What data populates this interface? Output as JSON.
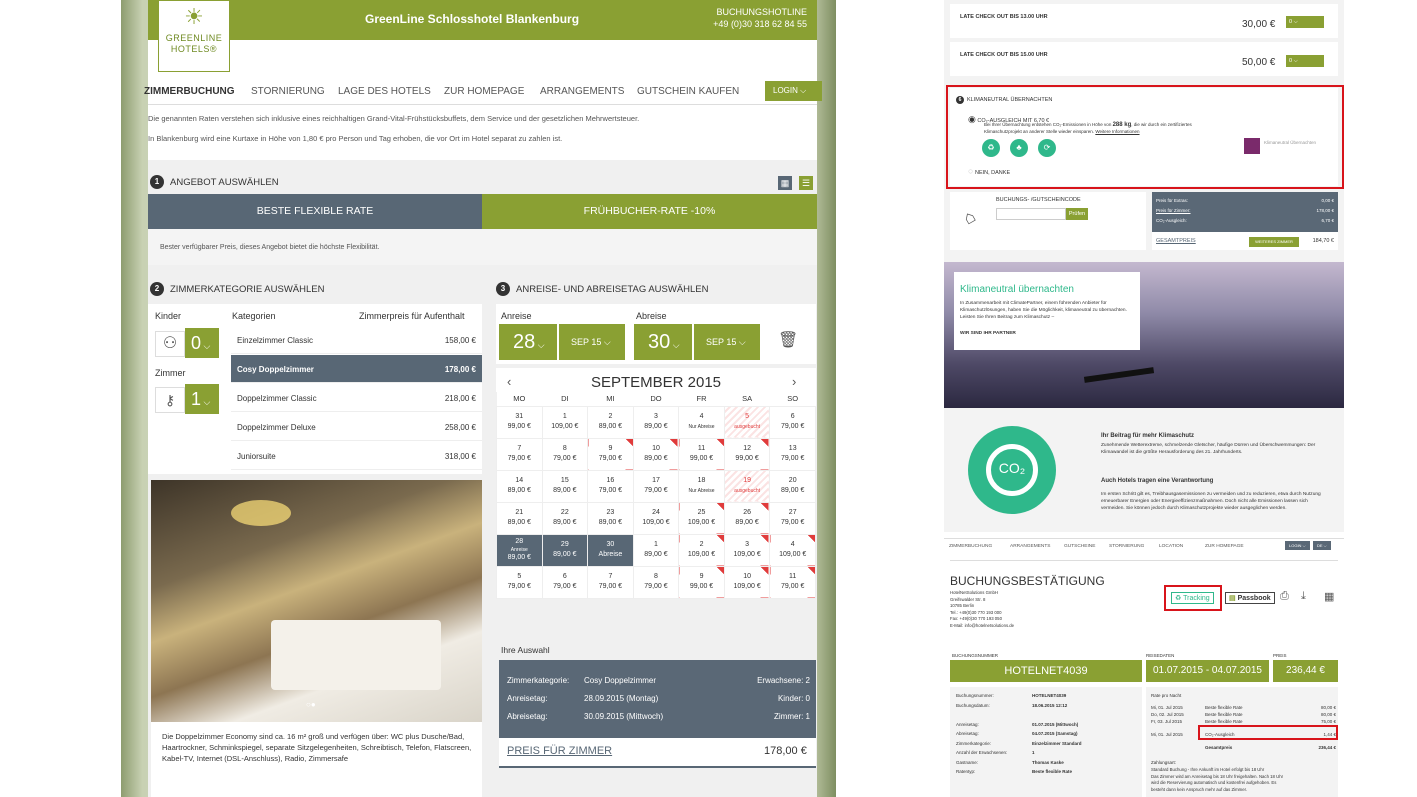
{
  "header": {
    "title": "GreenLine Schlosshotel Blankenburg",
    "hotline_label": "BUCHUNGSHOTLINE",
    "hotline_phone": "+49 (0)30 318 62 84 55",
    "logo_top": "GREENLINE",
    "logo_bottom": "HOTELS®"
  },
  "nav": {
    "items": [
      "ZIMMERBUCHUNG",
      "STORNIERUNG",
      "LAGE DES HOTELS",
      "ZUR HOMEPAGE",
      "ARRANGEMENTS",
      "GUTSCHEIN KAUFEN"
    ],
    "login": "LOGIN"
  },
  "info": {
    "line1": "Die genannten Raten verstehen sich inklusive eines reichhaltigen Grand-Vital-Frühstücksbuffets, dem Service und der gesetzlichen Mehrwertsteuer.",
    "line2": "In Blankenburg wird eine Kurtaxe in Höhe von 1,80 € pro Person und Tag erhoben, die vor Ort im Hotel separat zu zahlen ist."
  },
  "step1": {
    "num": "1",
    "title": "ANGEBOT AUSWÄHLEN",
    "tab1": "BESTE FLEXIBLE RATE",
    "tab2": "FRÜHBUCHER-RATE -10%",
    "desc": "Bester verfügbarer Preis, dieses Angebot bietet die höchste Flexibilität."
  },
  "step2": {
    "num": "2",
    "title": "ZIMMERKATEGORIE AUSWÄHLEN",
    "kinder_label": "Kinder",
    "kinder_value": "0",
    "zimmer_label": "Zimmer",
    "zimmer_value": "1",
    "col_categories": "Kategorien",
    "col_price": "Zimmerpreis für Aufenthalt",
    "rooms": [
      {
        "name": "Einzelzimmer Classic",
        "price": "158,00 €"
      },
      {
        "name": "Cosy Doppelzimmer",
        "price": "178,00 €"
      },
      {
        "name": "Doppelzimmer Classic",
        "price": "218,00 €"
      },
      {
        "name": "Doppelzimmer Deluxe",
        "price": "258,00 €"
      },
      {
        "name": "Juniorsuite",
        "price": "318,00 €"
      }
    ],
    "room_desc": "Die Doppelzimmer Economy sind ca. 16 m² groß und verfügen über: WC plus Dusche/Bad, Haartrockner, Schminkspiegel, separate Sitzgelegenheiten, Schreibtisch, Telefon, Flatscreen, Kabel-TV, Internet (DSL-Anschluss), Radio, Zimmersafe"
  },
  "step3": {
    "num": "3",
    "title": "ANREISE- UND ABREISETAG AUSWÄHLEN",
    "arrival_label": "Anreise",
    "departure_label": "Abreise",
    "arrival_day": "28",
    "arrival_month": "SEP 15",
    "departure_day": "30",
    "departure_month": "SEP 15",
    "month_title": "SEPTEMBER 2015",
    "weekdays": [
      "MO",
      "DI",
      "MI",
      "DO",
      "FR",
      "SA",
      "SO"
    ],
    "weeks": [
      [
        [
          "31",
          "99,00 €"
        ],
        [
          "1",
          "109,00 €"
        ],
        [
          "2",
          "89,00 €"
        ],
        [
          "3",
          "89,00 €"
        ],
        [
          "4",
          "Nur Abreise"
        ],
        [
          "5",
          "ausgebucht"
        ],
        [
          "6",
          "79,00 €"
        ]
      ],
      [
        [
          "7",
          "79,00 €"
        ],
        [
          "8",
          "79,00 €"
        ],
        [
          "9",
          "79,00 €"
        ],
        [
          "10",
          "89,00 €"
        ],
        [
          "11",
          "99,00 €"
        ],
        [
          "12",
          "99,00 €"
        ],
        [
          "13",
          "79,00 €"
        ]
      ],
      [
        [
          "14",
          "89,00 €"
        ],
        [
          "15",
          "89,00 €"
        ],
        [
          "16",
          "79,00 €"
        ],
        [
          "17",
          "79,00 €"
        ],
        [
          "18",
          "Nur Abreise"
        ],
        [
          "19",
          "ausgebucht"
        ],
        [
          "20",
          "89,00 €"
        ]
      ],
      [
        [
          "21",
          "89,00 €"
        ],
        [
          "22",
          "89,00 €"
        ],
        [
          "23",
          "89,00 €"
        ],
        [
          "24",
          "109,00 €"
        ],
        [
          "25",
          "109,00 €"
        ],
        [
          "26",
          "89,00 €"
        ],
        [
          "27",
          "79,00 €"
        ]
      ],
      [
        [
          "28",
          "89,00 €"
        ],
        [
          "29",
          "89,00 €"
        ],
        [
          "30",
          "Abreise"
        ],
        [
          "1",
          "89,00 €"
        ],
        [
          "2",
          "109,00 €"
        ],
        [
          "3",
          "109,00 €"
        ],
        [
          "4",
          "109,00 €"
        ]
      ],
      [
        [
          "5",
          "79,00 €"
        ],
        [
          "6",
          "79,00 €"
        ],
        [
          "7",
          "79,00 €"
        ],
        [
          "8",
          "79,00 €"
        ],
        [
          "9",
          "99,00 €"
        ],
        [
          "10",
          "109,00 €"
        ],
        [
          "11",
          "79,00 €"
        ]
      ]
    ],
    "arrival_tag": "Anreise",
    "your_choice": "Ihre Auswahl",
    "zk_label": "Zimmerkategorie:",
    "zk_value": "Cosy Doppelzimmer",
    "an_label": "Anreisetag:",
    "an_value": "28.09.2015 (Montag)",
    "ab_label": "Abreisetag:",
    "ab_value": "30.09.2015 (Mittwoch)",
    "adults": "Erwachsene: 2",
    "children": "Kinder: 0",
    "rooms": "Zimmer: 1",
    "price_link": "PREIS FÜR ZIMMER",
    "price_value": "178,00 €"
  },
  "right": {
    "late1": "LATE CHECK OUT BIS 13.00 UHR",
    "late1_price": "30,00 €",
    "late2": "LATE CHECK OUT BIS 15.00 UHR",
    "late2_price": "50,00 €",
    "qty": "0",
    "klima_title": "KLIMANEUTRAL ÜBERNACHTEN",
    "co2_option": "CO₂-AUSGLEICH MIT 6,70 €",
    "co2_text1": "Bei Ihrer Übernachtung entstehen CO₂-Emissionen in Höhe von",
    "co2_kg": "288 kg",
    "co2_text2": ", die wir durch ein zertifiziertes",
    "co2_text3": "Klimaschutzprojekt an anderer Stelle wieder einsparen.",
    "co2_more": "Weitere Informationen",
    "no_thanks": "NEIN, DANKE",
    "klima_badge": "Klimaneutral Übernachten",
    "code_label": "BUCHUNGS- /GUTSCHEINCODE",
    "code_btn": "Prüfen",
    "extras_label": "Preis für Extras:",
    "extras_val": "0,00 €",
    "room_label": "Preis für Zimmer:",
    "room_val": "178,00 €",
    "co2_label": "CO₂-Ausgleich:",
    "co2_val": "6,70 €",
    "total_label": "GESAMTPREIS",
    "more_rooms": "WEITERES ZIMMER",
    "total_val": "184,70 €",
    "promo_title": "Klimaneutral übernachten",
    "promo_text": "In Zusammenarbeit mit ClimatePartner, einem führenden Anbieter für Klimaschutzlösungen, haben Sie die Möglichkeit, klimaneutral zu übernachten. Leisten Sie Ihren Beitrag zum Klimaschutz –",
    "promo_bold": "WIR SIND IHR PARTNER",
    "co2_badge": "CO₂",
    "h1": "Ihr Beitrag für mehr Klimaschutz",
    "p1": "Zunehmende Wetterextreme, schmelzende Gletscher, häufige Dürren und Überschwemmungen: Der Klimawandel ist die größte Herausforderung des 21. Jahrhunderts.",
    "h2": "Auch Hotels tragen eine Verantwortung",
    "p2": "Im ersten Schritt gilt es, Treibhausgasemissionen zu vermeiden und zu reduzieren, etwa durch Nutzung erneuerbarer Energien oder Energieeffizienzmaßnahmen. Doch nicht alle Emissionen lassen sich vermeiden. Sie können jedoch durch Klimaschutzprojekte wieder ausgeglichen werden.",
    "conf_nav": [
      "ZIMMERBUCHUNG",
      "ARRANGEMENTS",
      "GUTSCHEINE",
      "STORNIERUNG",
      "LOCATION",
      "ZUR HOMEPAGE"
    ],
    "conf_login": "LOGIN",
    "conf_lang": "DE",
    "conf_title": "BUCHUNGSBESTÄTIGUNG",
    "company": [
      "HotelNetSolutions GmbH",
      "Greifswalder Str. 8",
      "10785 Berlin",
      "Tel.: +49(0)30 770 193 000",
      "Fax: +49(0)30 770 193 050",
      "E-Mail: info@hotelnetsolutions.de"
    ],
    "tracking": "Tracking",
    "passbook": "Passbook",
    "bn_label": "BUCHUNGSNUMMER",
    "reise_label": "REISEDATEN",
    "preis_label": "PREIS",
    "booking_no": "HOTELNET4039",
    "dates": "01.07.2015 - 04.07.2015",
    "price": "236,44 €",
    "details": [
      [
        "Buchungsnummer:",
        "HOTELNET4039"
      ],
      [
        "Buchungsdatum:",
        "18.06.2015 12:12"
      ],
      [
        "",
        ""
      ],
      [
        "Anreisetag:",
        "01.07.2015 (Mittwoch)"
      ],
      [
        "Abreisetag:",
        "04.07.2015 (Samstag)"
      ],
      [
        "Zimmerkategorie:",
        "Einzelzimmer Standard"
      ],
      [
        "Anzahl der Erwachsenen:",
        "1"
      ],
      [
        "Gastname:",
        "Thomas Kaske"
      ],
      [
        "Ratentyp:",
        "Beste flexible Rate"
      ]
    ],
    "rate_title": "Rate pro Nacht",
    "rates": [
      [
        "Mi, 01. Jul 2015",
        "Beste flexible Rate",
        "80,00 €"
      ],
      [
        "Do, 02. Jul 2015",
        "Beste flexible Rate",
        "80,00 €"
      ],
      [
        "Fr, 03. Jul 2015",
        "Beste flexible Rate",
        "75,00 €"
      ]
    ],
    "co2_row": [
      "Mi, 01. Jul 2015",
      "CO₂-Ausgleich",
      "1,44 €"
    ],
    "gesamt_label": "Gesamtpreis",
    "gesamt_val": "236,44 €",
    "payment_title": "Zahlungsart:",
    "payment_text": [
      "Standard Buchung - Ihre Ankunft im Hotel erfolgt bis 18 Uhr",
      "Das Zimmer wird am Anreisetag bis 18 Uhr freigehalten. Nach 18 Uhr",
      "wird die Reservierung automatisch und kostenfrei aufgehoben. Es",
      "besteht dann kein Anspruch mehr auf das Zimmer."
    ]
  }
}
